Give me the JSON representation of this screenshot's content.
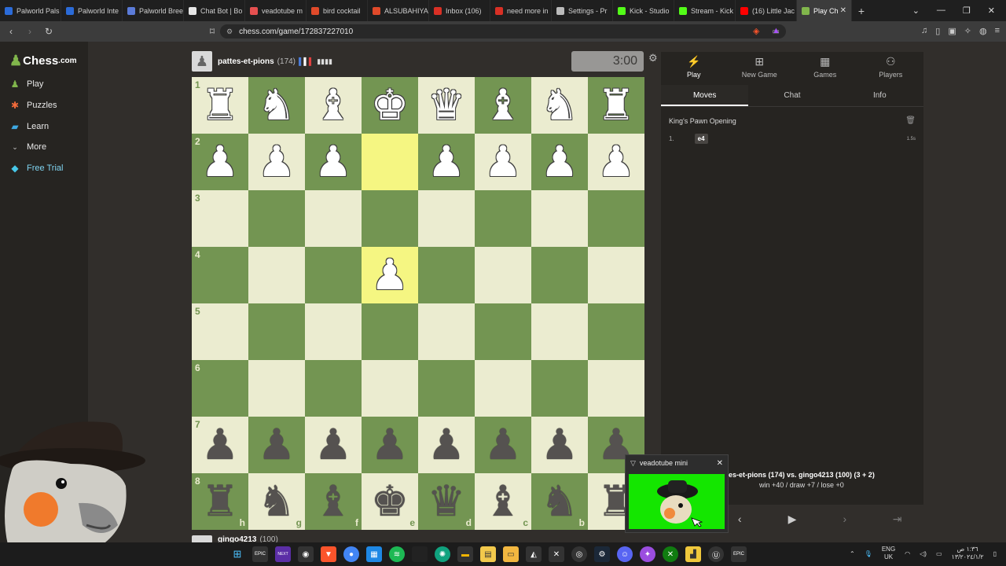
{
  "browser": {
    "tabs": [
      {
        "label": "Palworld Pals",
        "color": "#2b6bd8"
      },
      {
        "label": "Palworld Inte",
        "color": "#2b6bd8"
      },
      {
        "label": "Palworld Bree",
        "color": "#5b7bd8"
      },
      {
        "label": "Chat Bot | Bo",
        "color": "#e6e6e6"
      },
      {
        "label": "veadotube m",
        "color": "#e65050"
      },
      {
        "label": "bird cocktail",
        "color": "#e04a2a"
      },
      {
        "label": "ALSUBAHIYA",
        "color": "#e04a2a"
      },
      {
        "label": "Inbox (106)",
        "color": "#d93025"
      },
      {
        "label": "need more in",
        "color": "#d93025"
      },
      {
        "label": "Settings - Pr",
        "color": "#bbbbbb"
      },
      {
        "label": "Kick - Studio",
        "color": "#53fc18"
      },
      {
        "label": "Stream - Kick",
        "color": "#53fc18"
      },
      {
        "label": "(16) Little Jac",
        "color": "#ff0000"
      },
      {
        "label": "Play Ch",
        "color": "#81b64c"
      }
    ],
    "url": "chess.com/game/172837227010"
  },
  "nav": {
    "logo_main": "Chess",
    "logo_suffix": ".com",
    "items": [
      {
        "label": "Play",
        "icon": "play-pawn-icon"
      },
      {
        "label": "Puzzles",
        "icon": "puzzle-icon"
      },
      {
        "label": "Learn",
        "icon": "learn-icon"
      },
      {
        "label": "More",
        "icon": "chevron-down-icon"
      },
      {
        "label": "Free Trial",
        "icon": "diamond-icon"
      }
    ]
  },
  "top_player": {
    "name": "pattes-et-pions",
    "rating": "(174)",
    "clock": "3:00"
  },
  "bottom_player": {
    "name": "gingo4213",
    "rating": "(100)"
  },
  "board": {
    "ranks": [
      "1",
      "2",
      "3",
      "4",
      "5",
      "6",
      "7",
      "8"
    ],
    "files": [
      "h",
      "g",
      "f",
      "e",
      "d",
      "c",
      "b",
      "a"
    ],
    "rows": [
      [
        "wR",
        "wN",
        "wB",
        "wK",
        "wQ",
        "wB",
        "wN",
        "wR"
      ],
      [
        "wP",
        "wP",
        "wP",
        "",
        "wP",
        "wP",
        "wP",
        "wP"
      ],
      [
        "",
        "",
        "",
        "",
        "",
        "",
        "",
        ""
      ],
      [
        "",
        "",
        "",
        "wP",
        "",
        "",
        "",
        ""
      ],
      [
        "",
        "",
        "",
        "",
        "",
        "",
        "",
        ""
      ],
      [
        "",
        "",
        "",
        "",
        "",
        "",
        "",
        ""
      ],
      [
        "bP",
        "bP",
        "bP",
        "bP",
        "bP",
        "bP",
        "bP",
        "bP"
      ],
      [
        "bR",
        "bN",
        "bB",
        "bK",
        "bQ",
        "bB",
        "bN",
        "bR"
      ]
    ],
    "highlight": [
      "1-3",
      "3-3"
    ],
    "colors": {
      "light": "#ebecd0",
      "dark": "#739552",
      "highlight": "#f5f682"
    }
  },
  "panel": {
    "tabs": [
      {
        "label": "Play",
        "icon": "lightning-icon"
      },
      {
        "label": "New Game",
        "icon": "plus-square-icon"
      },
      {
        "label": "Games",
        "icon": "games-grid-icon"
      },
      {
        "label": "Players",
        "icon": "players-icon"
      }
    ],
    "subtabs": [
      "Moves",
      "Chat",
      "Info"
    ],
    "opening": "King's Pawn Opening",
    "move_number": "1.",
    "move": "e4",
    "move_time": "1.5s",
    "game_title_tail": "es-et-pions (174) vs. gingo4213 (100) (3 + 2)",
    "game_stakes": "win +40 / draw +7 / lose +0"
  },
  "popup": {
    "title": "veadotube mini",
    "bg": "#14e600"
  },
  "taskbar": {
    "lang_top": "ENG",
    "lang_bottom": "UK",
    "time": "١:٣٦ ﺹ",
    "date": "١٣/٢٠٢٤/١/٢"
  }
}
